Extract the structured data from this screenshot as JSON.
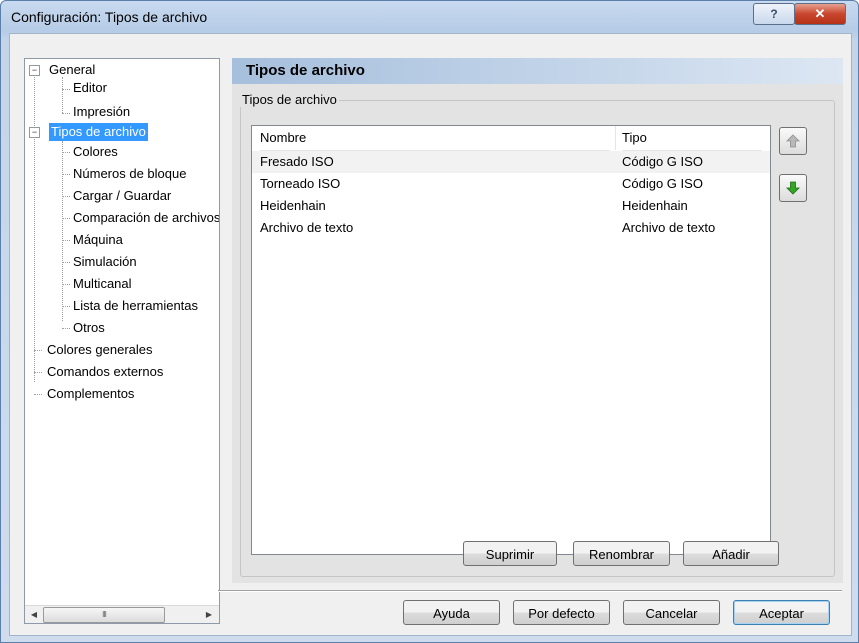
{
  "window": {
    "title": "Configuración: Tipos de archivo",
    "help_label": "?",
    "close_label": "✕"
  },
  "tree": {
    "items": [
      {
        "label": "General",
        "expander": "−"
      },
      {
        "label": "Editor"
      },
      {
        "label": "Impresión"
      },
      {
        "label": "Tipos de archivo",
        "expander": "−",
        "selected": true
      },
      {
        "label": "Colores"
      },
      {
        "label": "Números de bloque"
      },
      {
        "label": "Cargar / Guardar"
      },
      {
        "label": "Comparación de archivos"
      },
      {
        "label": "Máquina"
      },
      {
        "label": "Simulación"
      },
      {
        "label": "Multicanal"
      },
      {
        "label": "Lista de herramientas"
      },
      {
        "label": "Otros"
      },
      {
        "label": "Colores generales"
      },
      {
        "label": "Comandos externos"
      },
      {
        "label": "Complementos"
      }
    ],
    "scroll_left": "◀",
    "scroll_right": "▶",
    "scroll_grip": "III"
  },
  "panel": {
    "header": "Tipos de archivo",
    "group_label": "Tipos de archivo",
    "columns": {
      "name": "Nombre",
      "type": "Tipo"
    },
    "rows": [
      {
        "name": "Fresado ISO",
        "type": "Código G ISO"
      },
      {
        "name": "Torneado ISO",
        "type": "Código G ISO"
      },
      {
        "name": "Heidenhain",
        "type": "Heidenhain"
      },
      {
        "name": "Archivo de texto",
        "type": "Archivo de texto"
      }
    ],
    "delete_label": "Suprimir",
    "rename_label": "Renombrar",
    "add_label": "Añadir"
  },
  "footer": {
    "help_label": "Ayuda",
    "default_label": "Por defecto",
    "cancel_label": "Cancelar",
    "accept_label": "Aceptar"
  },
  "colors": {
    "selection": "#3399ff",
    "arrow_up": "#b0b0b0",
    "arrow_down": "#2e9a1e"
  }
}
